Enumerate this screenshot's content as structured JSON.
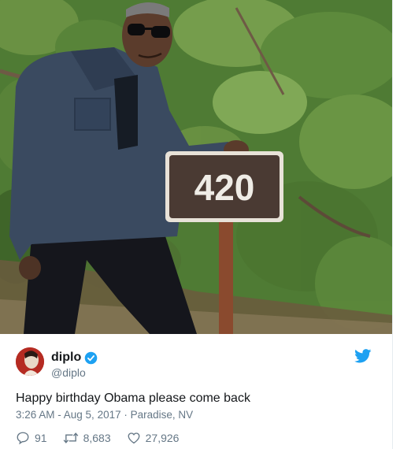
{
  "photo": {
    "sign_number": "420",
    "sign_bg": "#4a3a33",
    "sign_border": "#e8e2d8"
  },
  "user": {
    "display_name": "diplo",
    "handle": "@diplo",
    "verified": true
  },
  "tweet": {
    "text": "Happy birthday Obama please come back",
    "meta": "3:26 AM - Aug 5, 2017 · Paradise, NV"
  },
  "actions": {
    "replies": "91",
    "retweets": "8,683",
    "likes": "27,926"
  },
  "icons": {
    "verified": "verified-badge-icon",
    "brand": "twitter-bird-icon",
    "reply": "reply-icon",
    "retweet": "retweet-icon",
    "like": "heart-icon"
  },
  "colors": {
    "twitter_blue": "#1da1f2",
    "text_primary": "#14171a",
    "text_secondary": "#657786"
  }
}
